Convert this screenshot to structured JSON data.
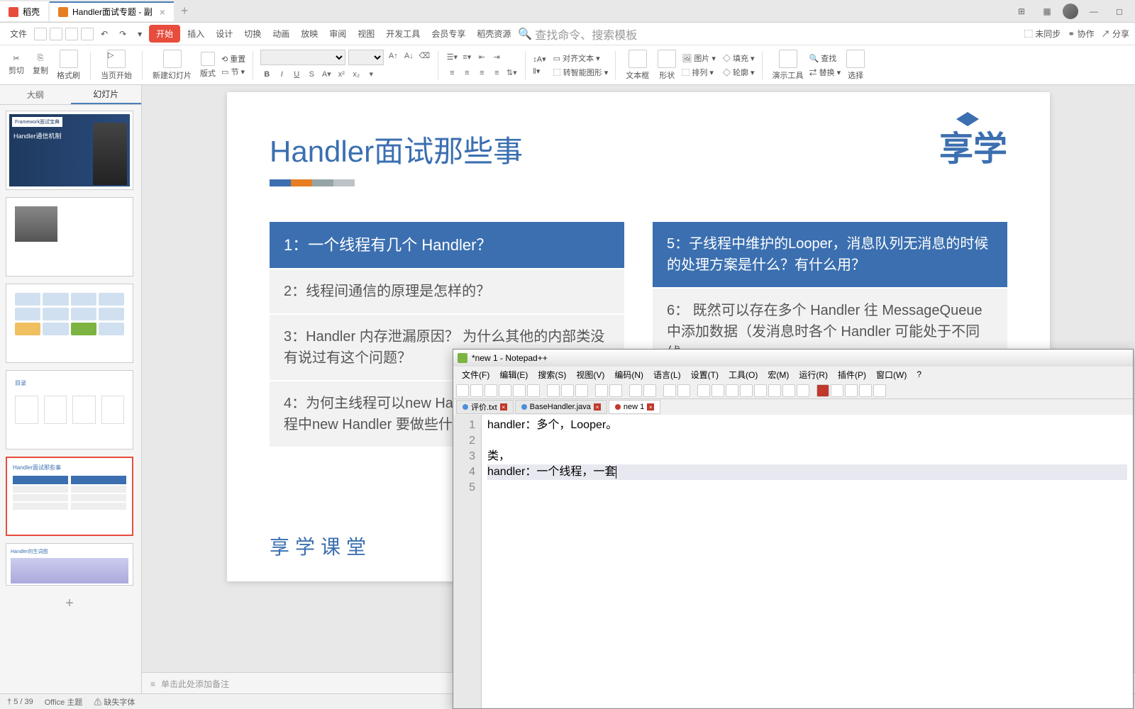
{
  "tabs": {
    "docker": "稻壳",
    "main": "Handler面试专题 - 副",
    "add": "+"
  },
  "topright": {
    "sync": "未同步",
    "collab": "协作",
    "share": "分享"
  },
  "menu": {
    "file": "文件",
    "start": "开始",
    "insert": "插入",
    "design": "设计",
    "trans": "切换",
    "anim": "动画",
    "show": "放映",
    "review": "审阅",
    "view": "视图",
    "devtools": "开发工具",
    "member": "会员专享",
    "docker": "稻壳资源",
    "search_ph": "查找命令、搜索模板"
  },
  "ribbon": {
    "cut": "剪切",
    "copy": "复制",
    "format": "格式刷",
    "pagestart": "当页开始",
    "newslide": "新建幻灯片",
    "layout": "版式",
    "section": "节",
    "reset": "重置",
    "align": "对齐文本",
    "smart": "转智能图形",
    "textbox": "文本框",
    "shape": "形状",
    "pic": "图片",
    "arrange": "排列",
    "fill": "填充",
    "outline": "轮廓",
    "demo": "演示工具",
    "find": "查找",
    "replace": "替换",
    "select": "选择"
  },
  "sidetabs": {
    "outline": "大纲",
    "slides": "幻灯片"
  },
  "slide": {
    "title": "Handler面试那些事",
    "logo": "享学",
    "q1": "1：一个线程有几个 Handler？",
    "q2": "2：线程间通信的原理是怎样的？",
    "q3": "3：Handler 内存泄漏原因？  为什么其他的内部类没有说过有这个问题？",
    "q4": "4：为何主线程可以new Handler？如果想要在子线程中new Handler 要做些什么准备？",
    "q5": "5：子线程中维护的Looper，消息队列无消息的时候的处理方案是什么？有什么用？",
    "q6": "6： 既然可以存在多个 Handler 往 MessageQueue 中添加数据（发消息时各个 Handler 可能处于不同线",
    "brand": "享学课堂"
  },
  "notes": "单击此处添加备注",
  "status": {
    "page": "5 / 39",
    "theme": "Office 主题",
    "missing": "缺失字体"
  },
  "thumbs": {
    "t1_badge": "Framework面试宝典",
    "t1_title": "Handler通信机制",
    "t5_title": "Handler面试那些事",
    "t6_title": "Handler的生词图"
  },
  "npp": {
    "title": "*new 1 - Notepad++",
    "menu": [
      "文件(F)",
      "编辑(E)",
      "搜索(S)",
      "视图(V)",
      "编码(N)",
      "语言(L)",
      "设置(T)",
      "工具(O)",
      "宏(M)",
      "运行(R)",
      "插件(P)",
      "窗口(W)",
      "?"
    ],
    "tabs": {
      "t1": "评价.txt",
      "t2": "BaseHandler.java",
      "t3": "new 1"
    },
    "lines": {
      "l1": "handler：多个，Looper。",
      "l2": "",
      "l3": "类，",
      "l4": "handler：一个线程，一套",
      "l5": ""
    }
  }
}
